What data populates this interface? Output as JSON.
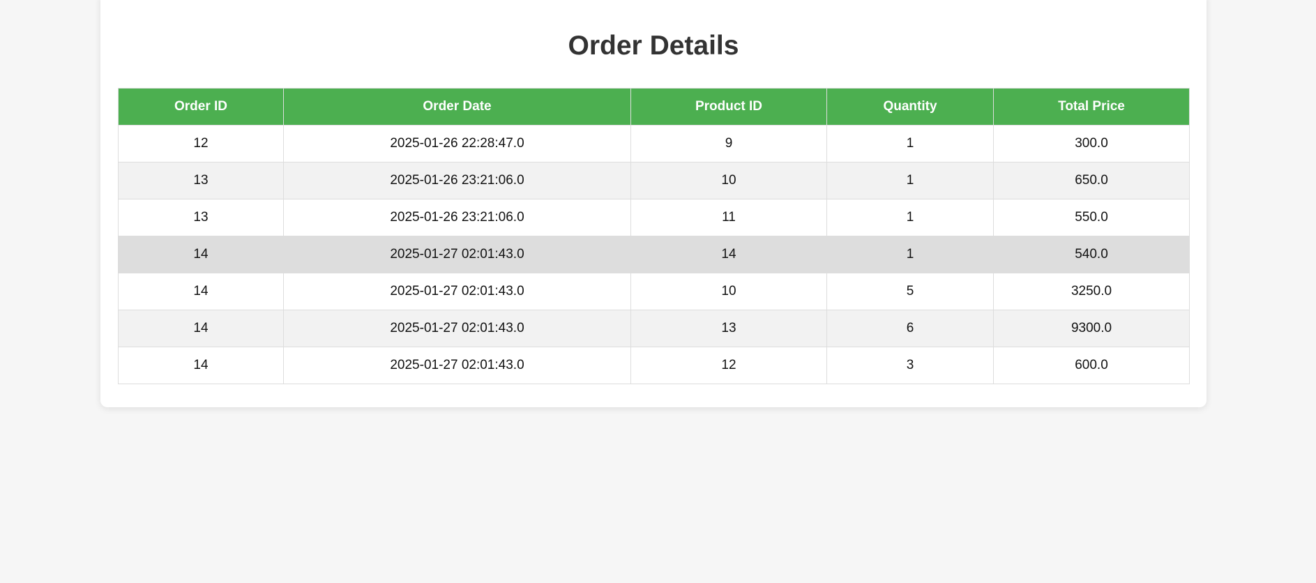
{
  "page": {
    "title": "Order Details"
  },
  "colors": {
    "header_bg": "#4caf50",
    "header_text": "#ffffff",
    "stripe": "#f2f2f2",
    "hover_row": "#dddddd",
    "page_bg": "#f6f6f6"
  },
  "table": {
    "headers": [
      "Order ID",
      "Order Date",
      "Product ID",
      "Quantity",
      "Total Price"
    ],
    "hovered_row_index": 3,
    "rows": [
      [
        "12",
        "2025-01-26 22:28:47.0",
        "9",
        "1",
        "300.0"
      ],
      [
        "13",
        "2025-01-26 23:21:06.0",
        "10",
        "1",
        "650.0"
      ],
      [
        "13",
        "2025-01-26 23:21:06.0",
        "11",
        "1",
        "550.0"
      ],
      [
        "14",
        "2025-01-27 02:01:43.0",
        "14",
        "1",
        "540.0"
      ],
      [
        "14",
        "2025-01-27 02:01:43.0",
        "10",
        "5",
        "3250.0"
      ],
      [
        "14",
        "2025-01-27 02:01:43.0",
        "13",
        "6",
        "9300.0"
      ],
      [
        "14",
        "2025-01-27 02:01:43.0",
        "12",
        "3",
        "600.0"
      ]
    ]
  }
}
